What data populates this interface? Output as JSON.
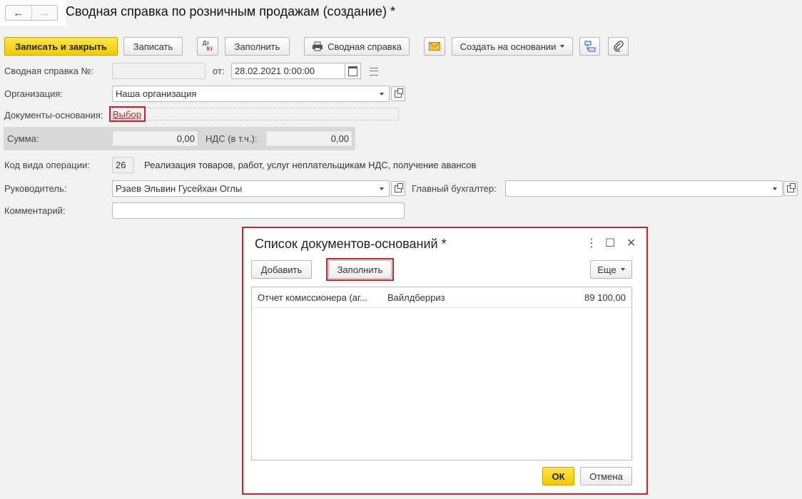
{
  "window": {
    "title": "Сводная справка по розничным продажам (создание) *",
    "back_icon": "←",
    "forward_icon": "→"
  },
  "toolbar": {
    "save_close": "Записать и закрыть",
    "save": "Записать",
    "dtkt_top": "Дт",
    "dtkt_bottom": "Кт",
    "fill": "Заполнить",
    "print": "Сводная справка",
    "create_basis": "Создать на основании"
  },
  "form": {
    "number_label": "Сводная справка №:",
    "number_value": "",
    "date_label": "от:",
    "date_value": "28.02.2021  0:00:00",
    "org_label": "Организация:",
    "org_value": "Наша организация",
    "basis_docs_label": "Документы-основания:",
    "basis_docs_link": "Выбор",
    "sum_label": "Сумма:",
    "sum_value": "0,00",
    "vat_label": "НДС (в т.ч.):",
    "vat_value": "0,00",
    "opcode_label": "Код вида операции:",
    "opcode_value": "26",
    "opcode_desc": "Реализация товаров, работ, услуг неплательщикам НДС, получение авансов",
    "head_label": "Руководитель:",
    "head_value": "Рзаев Эльвин Гусейхан Оглы",
    "accountant_label": "Главный бухгалтер:",
    "accountant_value": "",
    "comment_label": "Комментарий:",
    "comment_value": ""
  },
  "dialog": {
    "title": "Список документов-оснований *",
    "more_icon": "⋮",
    "maximize_icon": "☐",
    "close_icon": "✕",
    "add": "Добавить",
    "fill": "Заполнить",
    "more": "Еще",
    "rows": [
      {
        "doc": "Отчет комиссионера (аг...",
        "counterparty": "Вайлдберриз",
        "amount": "89 100,00"
      }
    ],
    "ok": "ОК",
    "cancel": "Отмена"
  },
  "colors": {
    "accent_yellow": "#f5d40f",
    "highlight_red": "#d0202a",
    "link": "#a6341f"
  }
}
